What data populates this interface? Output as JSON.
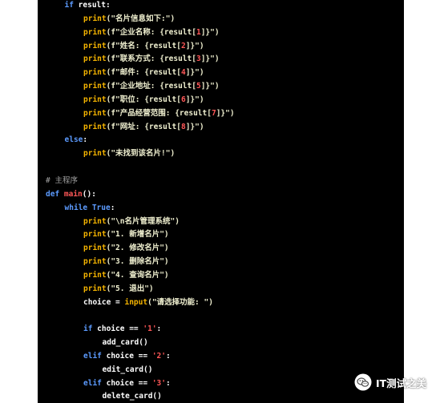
{
  "code_lines": [
    {
      "indent": 1,
      "tokens": [
        {
          "t": "if ",
          "c": "k"
        },
        {
          "t": "result:",
          "c": "t"
        }
      ]
    },
    {
      "indent": 2,
      "tokens": [
        {
          "t": "print",
          "c": "f"
        },
        {
          "t": "(\"名片信息如下:\")",
          "c": "s"
        }
      ]
    },
    {
      "indent": 2,
      "tokens": [
        {
          "t": "print",
          "c": "f"
        },
        {
          "t": "(f\"企业名称: {result[",
          "c": "s"
        },
        {
          "t": "1",
          "c": "n"
        },
        {
          "t": "]}\")",
          "c": "s"
        }
      ]
    },
    {
      "indent": 2,
      "tokens": [
        {
          "t": "print",
          "c": "f"
        },
        {
          "t": "(f\"姓名: {result[",
          "c": "s"
        },
        {
          "t": "2",
          "c": "n"
        },
        {
          "t": "]}\")",
          "c": "s"
        }
      ]
    },
    {
      "indent": 2,
      "tokens": [
        {
          "t": "print",
          "c": "f"
        },
        {
          "t": "(f\"联系方式: {result[",
          "c": "s"
        },
        {
          "t": "3",
          "c": "n"
        },
        {
          "t": "]}\")",
          "c": "s"
        }
      ]
    },
    {
      "indent": 2,
      "tokens": [
        {
          "t": "print",
          "c": "f"
        },
        {
          "t": "(f\"邮件: {result[",
          "c": "s"
        },
        {
          "t": "4",
          "c": "n"
        },
        {
          "t": "]}\")",
          "c": "s"
        }
      ]
    },
    {
      "indent": 2,
      "tokens": [
        {
          "t": "print",
          "c": "f"
        },
        {
          "t": "(f\"企业地址: {result[",
          "c": "s"
        },
        {
          "t": "5",
          "c": "n"
        },
        {
          "t": "]}\")",
          "c": "s"
        }
      ]
    },
    {
      "indent": 2,
      "tokens": [
        {
          "t": "print",
          "c": "f"
        },
        {
          "t": "(f\"职位: {result[",
          "c": "s"
        },
        {
          "t": "6",
          "c": "n"
        },
        {
          "t": "]}\")",
          "c": "s"
        }
      ]
    },
    {
      "indent": 2,
      "tokens": [
        {
          "t": "print",
          "c": "f"
        },
        {
          "t": "(f\"产品经营范围: {result[",
          "c": "s"
        },
        {
          "t": "7",
          "c": "n"
        },
        {
          "t": "]}\")",
          "c": "s"
        }
      ]
    },
    {
      "indent": 2,
      "tokens": [
        {
          "t": "print",
          "c": "f"
        },
        {
          "t": "(f\"网址: {result[",
          "c": "s"
        },
        {
          "t": "8",
          "c": "n"
        },
        {
          "t": "]}\")",
          "c": "s"
        }
      ]
    },
    {
      "indent": 1,
      "tokens": [
        {
          "t": "else",
          "c": "k"
        },
        {
          "t": ":",
          "c": "t"
        }
      ]
    },
    {
      "indent": 2,
      "tokens": [
        {
          "t": "print",
          "c": "f"
        },
        {
          "t": "(\"未找到该名片!\")",
          "c": "s"
        }
      ]
    },
    {
      "indent": 0,
      "tokens": []
    },
    {
      "indent": 0,
      "tokens": [
        {
          "t": "# 主程序",
          "c": "c"
        }
      ]
    },
    {
      "indent": 0,
      "tokens": [
        {
          "t": "def ",
          "c": "k"
        },
        {
          "t": "main",
          "c": "n"
        },
        {
          "t": "():",
          "c": "t"
        }
      ]
    },
    {
      "indent": 1,
      "tokens": [
        {
          "t": "while ",
          "c": "k"
        },
        {
          "t": "True",
          "c": "k"
        },
        {
          "t": ":",
          "c": "t"
        }
      ]
    },
    {
      "indent": 2,
      "tokens": [
        {
          "t": "print",
          "c": "f"
        },
        {
          "t": "(\"\\n名片管理系统\")",
          "c": "s"
        }
      ]
    },
    {
      "indent": 2,
      "tokens": [
        {
          "t": "print",
          "c": "f"
        },
        {
          "t": "(\"1. 新增名片\")",
          "c": "s"
        }
      ]
    },
    {
      "indent": 2,
      "tokens": [
        {
          "t": "print",
          "c": "f"
        },
        {
          "t": "(\"2. 修改名片\")",
          "c": "s"
        }
      ]
    },
    {
      "indent": 2,
      "tokens": [
        {
          "t": "print",
          "c": "f"
        },
        {
          "t": "(\"3. 删除名片\")",
          "c": "s"
        }
      ]
    },
    {
      "indent": 2,
      "tokens": [
        {
          "t": "print",
          "c": "f"
        },
        {
          "t": "(\"4. 查询名片\")",
          "c": "s"
        }
      ]
    },
    {
      "indent": 2,
      "tokens": [
        {
          "t": "print",
          "c": "f"
        },
        {
          "t": "(\"5. 退出\")",
          "c": "s"
        }
      ]
    },
    {
      "indent": 2,
      "tokens": [
        {
          "t": "choice = ",
          "c": "t"
        },
        {
          "t": "input",
          "c": "f"
        },
        {
          "t": "(\"请选择功能: \")",
          "c": "s"
        }
      ]
    },
    {
      "indent": 0,
      "tokens": []
    },
    {
      "indent": 2,
      "tokens": [
        {
          "t": "if ",
          "c": "k"
        },
        {
          "t": "choice == ",
          "c": "t"
        },
        {
          "t": "'1'",
          "c": "n"
        },
        {
          "t": ":",
          "c": "t"
        }
      ]
    },
    {
      "indent": 3,
      "tokens": [
        {
          "t": "add_card()",
          "c": "t"
        }
      ]
    },
    {
      "indent": 2,
      "tokens": [
        {
          "t": "elif ",
          "c": "k"
        },
        {
          "t": "choice == ",
          "c": "t"
        },
        {
          "t": "'2'",
          "c": "n"
        },
        {
          "t": ":",
          "c": "t"
        }
      ]
    },
    {
      "indent": 3,
      "tokens": [
        {
          "t": "edit_card()",
          "c": "t"
        }
      ]
    },
    {
      "indent": 2,
      "tokens": [
        {
          "t": "elif ",
          "c": "k"
        },
        {
          "t": "choice == ",
          "c": "t"
        },
        {
          "t": "'3'",
          "c": "n"
        },
        {
          "t": ":",
          "c": "t"
        }
      ]
    },
    {
      "indent": 3,
      "tokens": [
        {
          "t": "delete_card()",
          "c": "t"
        }
      ]
    }
  ],
  "watermark": {
    "text": "IT测试之美",
    "icon": "wechat-icon"
  }
}
